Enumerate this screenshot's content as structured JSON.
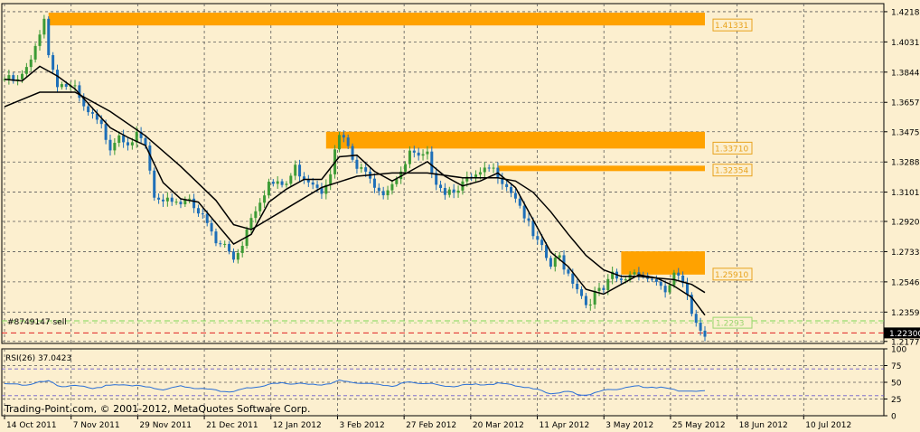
{
  "colors": {
    "background": "#FCEFCF",
    "grid": "#5A5A5A",
    "bull": "#3D9B35",
    "bear": "#1E6FB8",
    "wick": "#2C8A9C",
    "ma": "#000000",
    "zone": "#FFA200",
    "zone_label_border": "#E8A21C",
    "zone_label_text": "#E8A21C",
    "order_line": "#7ED957",
    "price_line": "#E02020",
    "last_price_bg": "#000000",
    "rsi_line": "#2A6FD6",
    "rsi_level": "#6A5ACD"
  },
  "chart_data": [
    {
      "type": "candlestick",
      "symbol_note": "",
      "y_axis_labels": [
        "1.42180",
        "1.40310",
        "1.38440",
        "1.36570",
        "1.34750",
        "1.32880",
        "1.31015",
        "1.29200",
        "1.27330",
        "1.25460",
        "1.23590",
        "1.21775"
      ],
      "ylim": [
        1.2165,
        1.4268
      ],
      "x_axis_labels": [
        "14 Oct 2011",
        "7 Nov 2011",
        "29 Nov 2011",
        "21 Dec 2011",
        "12 Jan 2012",
        "3 Feb 2012",
        "27 Feb 2012",
        "20 Mar 2012",
        "11 Apr 2012",
        "3 May 2012",
        "25 May 2012",
        "18 Jun 2012",
        "10 Jul 2012"
      ],
      "price_path": [
        [
          0,
          1.38
        ],
        [
          3,
          1.378
        ],
        [
          6,
          1.39
        ],
        [
          8,
          1.41
        ],
        [
          9,
          1.419
        ],
        [
          10,
          1.395
        ],
        [
          12,
          1.378
        ],
        [
          14,
          1.376
        ],
        [
          16,
          1.373
        ],
        [
          18,
          1.361
        ],
        [
          20,
          1.356
        ],
        [
          22,
          1.35
        ],
        [
          24,
          1.339
        ],
        [
          26,
          1.347
        ],
        [
          28,
          1.342
        ],
        [
          30,
          1.344
        ],
        [
          32,
          1.338
        ],
        [
          34,
          1.306
        ],
        [
          36,
          1.301
        ],
        [
          38,
          1.306
        ],
        [
          40,
          1.304
        ],
        [
          42,
          1.308
        ],
        [
          44,
          1.298
        ],
        [
          46,
          1.29
        ],
        [
          48,
          1.278
        ],
        [
          50,
          1.277
        ],
        [
          52,
          1.269
        ],
        [
          54,
          1.279
        ],
        [
          56,
          1.296
        ],
        [
          58,
          1.306
        ],
        [
          60,
          1.316
        ],
        [
          62,
          1.314
        ],
        [
          64,
          1.315
        ],
        [
          66,
          1.325
        ],
        [
          68,
          1.32
        ],
        [
          70,
          1.317
        ],
        [
          72,
          1.312
        ],
        [
          74,
          1.324
        ],
        [
          76,
          1.345
        ],
        [
          78,
          1.338
        ],
        [
          80,
          1.322
        ],
        [
          82,
          1.326
        ],
        [
          84,
          1.316
        ],
        [
          86,
          1.31
        ],
        [
          88,
          1.317
        ],
        [
          90,
          1.32
        ],
        [
          92,
          1.334
        ],
        [
          94,
          1.33
        ],
        [
          96,
          1.332
        ],
        [
          98,
          1.318
        ],
        [
          100,
          1.311
        ],
        [
          102,
          1.313
        ],
        [
          104,
          1.315
        ],
        [
          106,
          1.318
        ],
        [
          108,
          1.32
        ],
        [
          110,
          1.324
        ],
        [
          112,
          1.322
        ],
        [
          114,
          1.315
        ],
        [
          116,
          1.308
        ],
        [
          118,
          1.296
        ],
        [
          120,
          1.282
        ],
        [
          122,
          1.274
        ],
        [
          124,
          1.264
        ],
        [
          126,
          1.27
        ],
        [
          128,
          1.26
        ],
        [
          130,
          1.252
        ],
        [
          132,
          1.241
        ],
        [
          134,
          1.247
        ],
        [
          136,
          1.249
        ],
        [
          138,
          1.258
        ],
        [
          140,
          1.254
        ],
        [
          142,
          1.26
        ],
        [
          144,
          1.262
        ],
        [
          146,
          1.257
        ],
        [
          148,
          1.256
        ],
        [
          150,
          1.245
        ],
        [
          152,
          1.26
        ],
        [
          154,
          1.252
        ],
        [
          156,
          1.235
        ],
        [
          158,
          1.227
        ],
        [
          159,
          1.223
        ]
      ],
      "moving_average_fast": [
        [
          0,
          1.38
        ],
        [
          4,
          1.379
        ],
        [
          8,
          1.388
        ],
        [
          12,
          1.382
        ],
        [
          16,
          1.374
        ],
        [
          20,
          1.362
        ],
        [
          24,
          1.35
        ],
        [
          28,
          1.344
        ],
        [
          32,
          1.339
        ],
        [
          36,
          1.316
        ],
        [
          40,
          1.306
        ],
        [
          44,
          1.304
        ],
        [
          48,
          1.291
        ],
        [
          52,
          1.278
        ],
        [
          56,
          1.284
        ],
        [
          60,
          1.304
        ],
        [
          64,
          1.312
        ],
        [
          68,
          1.318
        ],
        [
          72,
          1.318
        ],
        [
          76,
          1.332
        ],
        [
          80,
          1.333
        ],
        [
          84,
          1.323
        ],
        [
          88,
          1.317
        ],
        [
          92,
          1.323
        ],
        [
          96,
          1.329
        ],
        [
          100,
          1.32
        ],
        [
          104,
          1.314
        ],
        [
          108,
          1.317
        ],
        [
          112,
          1.322
        ],
        [
          116,
          1.313
        ],
        [
          120,
          1.293
        ],
        [
          124,
          1.273
        ],
        [
          128,
          1.264
        ],
        [
          132,
          1.25
        ],
        [
          136,
          1.247
        ],
        [
          140,
          1.253
        ],
        [
          144,
          1.259
        ],
        [
          148,
          1.257
        ],
        [
          152,
          1.252
        ],
        [
          156,
          1.245
        ],
        [
          159,
          1.234
        ]
      ],
      "moving_average_slow": [
        [
          0,
          1.363
        ],
        [
          8,
          1.372
        ],
        [
          16,
          1.372
        ],
        [
          24,
          1.36
        ],
        [
          32,
          1.345
        ],
        [
          40,
          1.326
        ],
        [
          48,
          1.305
        ],
        [
          52,
          1.29
        ],
        [
          56,
          1.287
        ],
        [
          64,
          1.3
        ],
        [
          72,
          1.313
        ],
        [
          80,
          1.32
        ],
        [
          88,
          1.322
        ],
        [
          96,
          1.322
        ],
        [
          104,
          1.319
        ],
        [
          112,
          1.319
        ],
        [
          116,
          1.317
        ],
        [
          120,
          1.31
        ],
        [
          124,
          1.298
        ],
        [
          128,
          1.284
        ],
        [
          132,
          1.271
        ],
        [
          136,
          1.262
        ],
        [
          140,
          1.258
        ],
        [
          144,
          1.258
        ],
        [
          148,
          1.257
        ],
        [
          152,
          1.256
        ],
        [
          156,
          1.253
        ],
        [
          159,
          1.248
        ]
      ],
      "zones": [
        {
          "top": 1.4212,
          "bottom": 1.4133,
          "start": 10,
          "label": "1.41331"
        },
        {
          "top": 1.3475,
          "bottom": 1.3371,
          "start": 73,
          "label": "1.33710"
        },
        {
          "top": 1.3265,
          "bottom": 1.3235,
          "start": 112,
          "label": "1.32354"
        },
        {
          "top": 1.2735,
          "bottom": 1.2591,
          "start": 140,
          "label": "1.25910"
        }
      ],
      "last_price": "1.22300",
      "current_price_label": "1.2293",
      "order_label": "#8749147 sell",
      "order_level": 1.2305,
      "price_level": 1.223,
      "current_level": 1.2293
    },
    {
      "type": "line",
      "indicator_label": "RSI(26) 37.0423",
      "y_axis_labels": [
        "100",
        "75",
        "50",
        "25",
        "0"
      ],
      "ylim": [
        0,
        100
      ],
      "levels": [
        30,
        70
      ],
      "rsi_path": [
        [
          0,
          48
        ],
        [
          4,
          46
        ],
        [
          8,
          50
        ],
        [
          10,
          52
        ],
        [
          12,
          45
        ],
        [
          16,
          44
        ],
        [
          20,
          42
        ],
        [
          24,
          45
        ],
        [
          28,
          47
        ],
        [
          32,
          43
        ],
        [
          36,
          40
        ],
        [
          40,
          44
        ],
        [
          44,
          41
        ],
        [
          48,
          38
        ],
        [
          52,
          36
        ],
        [
          56,
          42
        ],
        [
          60,
          47
        ],
        [
          64,
          49
        ],
        [
          68,
          47
        ],
        [
          72,
          46
        ],
        [
          76,
          52
        ],
        [
          80,
          50
        ],
        [
          84,
          46
        ],
        [
          88,
          45
        ],
        [
          92,
          50
        ],
        [
          96,
          49
        ],
        [
          100,
          44
        ],
        [
          104,
          45
        ],
        [
          108,
          47
        ],
        [
          112,
          48
        ],
        [
          116,
          45
        ],
        [
          120,
          40
        ],
        [
          124,
          34
        ],
        [
          128,
          35
        ],
        [
          132,
          31
        ],
        [
          136,
          38
        ],
        [
          140,
          41
        ],
        [
          144,
          44
        ],
        [
          148,
          43
        ],
        [
          152,
          39
        ],
        [
          156,
          36
        ],
        [
          159,
          37
        ]
      ]
    }
  ],
  "footer": {
    "copyright": "Trading-Point.com, © 2001-2012, MetaQuotes Software Corp."
  }
}
